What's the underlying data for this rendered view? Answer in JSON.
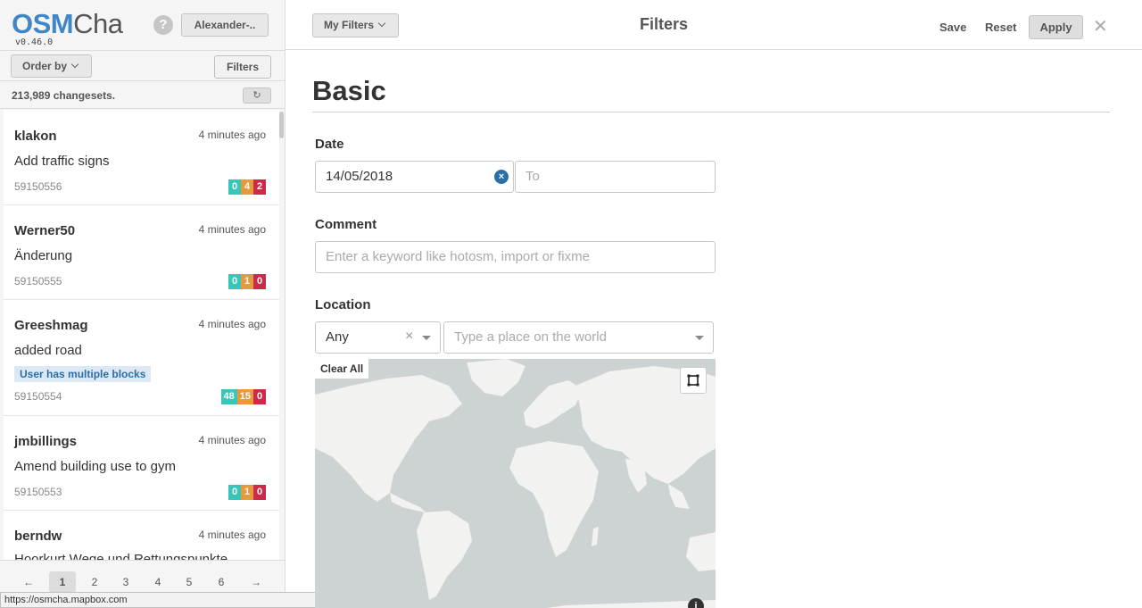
{
  "brand": {
    "logo_osm": "OSM",
    "logo_cha": "Cha",
    "version": "v0.46.0"
  },
  "header_user": {
    "help": "?",
    "username": "Alexander-.."
  },
  "sidebar": {
    "order_by": "Order by",
    "filters": "Filters",
    "count": "213,989 changesets.",
    "refresh_icon": "↻"
  },
  "changesets": [
    {
      "user": "klakon",
      "time": "4 minutes ago",
      "comment": "Add traffic signs",
      "id": "59150556",
      "counts": [
        "0",
        "4",
        "2"
      ]
    },
    {
      "user": "Werner50",
      "time": "4 minutes ago",
      "comment": "Änderung",
      "id": "59150555",
      "counts": [
        "0",
        "1",
        "0"
      ]
    },
    {
      "user": "Greeshmag",
      "time": "4 minutes ago",
      "comment": "added road",
      "flag": "User has multiple blocks",
      "id": "59150554",
      "counts": [
        "48",
        "15",
        "0"
      ]
    },
    {
      "user": "jmbillings",
      "time": "4 minutes ago",
      "comment": "Amend building use to gym",
      "id": "59150553",
      "counts": [
        "0",
        "1",
        "0"
      ]
    },
    {
      "user": "berndw",
      "time": "4 minutes ago",
      "comment": "Hoorkurt Wege und Rettungspunkte"
    }
  ],
  "count_colors": {
    "create": "#39c5b8",
    "modify": "#e59a3b",
    "delete": "#cc2a49"
  },
  "pager": {
    "prev": "←",
    "next": "→",
    "pages": [
      "1",
      "2",
      "3",
      "4",
      "5",
      "6"
    ],
    "current": "1"
  },
  "status_url": "https://osmcha.mapbox.com",
  "main": {
    "my_filters": "My Filters",
    "title": "Filters",
    "save": "Save",
    "reset": "Reset",
    "apply": "Apply",
    "close": "✕",
    "section": "Basic",
    "date_label": "Date",
    "date_from": "14/05/2018",
    "date_to_placeholder": "To",
    "comment_label": "Comment",
    "comment_placeholder": "Enter a keyword like hotosm, import or fixme",
    "location_label": "Location",
    "location_mode": "Any",
    "location_clear": "×",
    "place_placeholder": "Type a place on the world",
    "map_clear_all": "Clear All",
    "map_info": "i"
  }
}
